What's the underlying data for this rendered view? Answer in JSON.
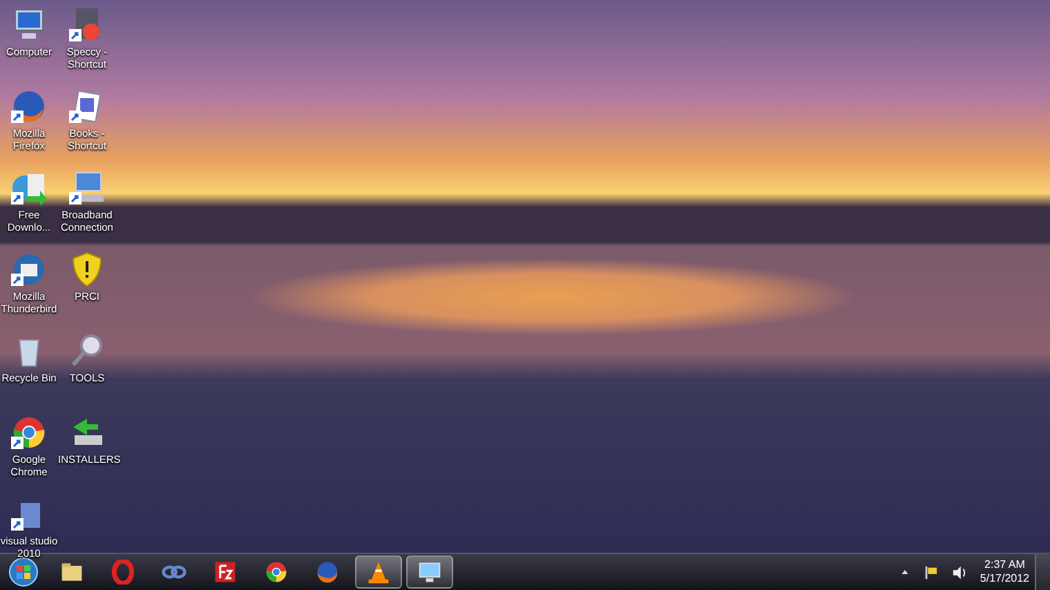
{
  "desktop_icons": [
    {
      "label": "Computer",
      "kind": "computer",
      "shortcut": false
    },
    {
      "label": "Speccy - Shortcut",
      "kind": "app",
      "shortcut": true
    },
    {
      "label": "Mozilla Firefox",
      "kind": "firefox",
      "shortcut": true
    },
    {
      "label": "Books - Shortcut",
      "kind": "document",
      "shortcut": true
    },
    {
      "label": "Free Downlo...",
      "kind": "download",
      "shortcut": true
    },
    {
      "label": "Broadband Connection",
      "kind": "network",
      "shortcut": true
    },
    {
      "label": "Mozilla Thunderbird",
      "kind": "mail",
      "shortcut": true
    },
    {
      "label": "PRCI",
      "kind": "shield",
      "shortcut": false
    },
    {
      "label": "Recycle Bin",
      "kind": "trash",
      "shortcut": false
    },
    {
      "label": "TOOLS",
      "kind": "search",
      "shortcut": false
    },
    {
      "label": "Google Chrome",
      "kind": "chrome",
      "shortcut": true
    },
    {
      "label": "INSTALLERS",
      "kind": "installer",
      "shortcut": false
    },
    {
      "label": "visual studio 2010",
      "kind": "blank",
      "shortcut": true
    }
  ],
  "taskbar": {
    "items": [
      {
        "kind": "folder",
        "running": false
      },
      {
        "kind": "opera",
        "running": false
      },
      {
        "kind": "link",
        "running": false
      },
      {
        "kind": "filezilla",
        "running": false
      },
      {
        "kind": "chrome",
        "running": false
      },
      {
        "kind": "firefox",
        "running": false
      },
      {
        "kind": "vlc",
        "running": true
      },
      {
        "kind": "monitor",
        "running": true
      }
    ],
    "clock": {
      "time": "2:37 AM",
      "date": "5/17/2012"
    }
  }
}
